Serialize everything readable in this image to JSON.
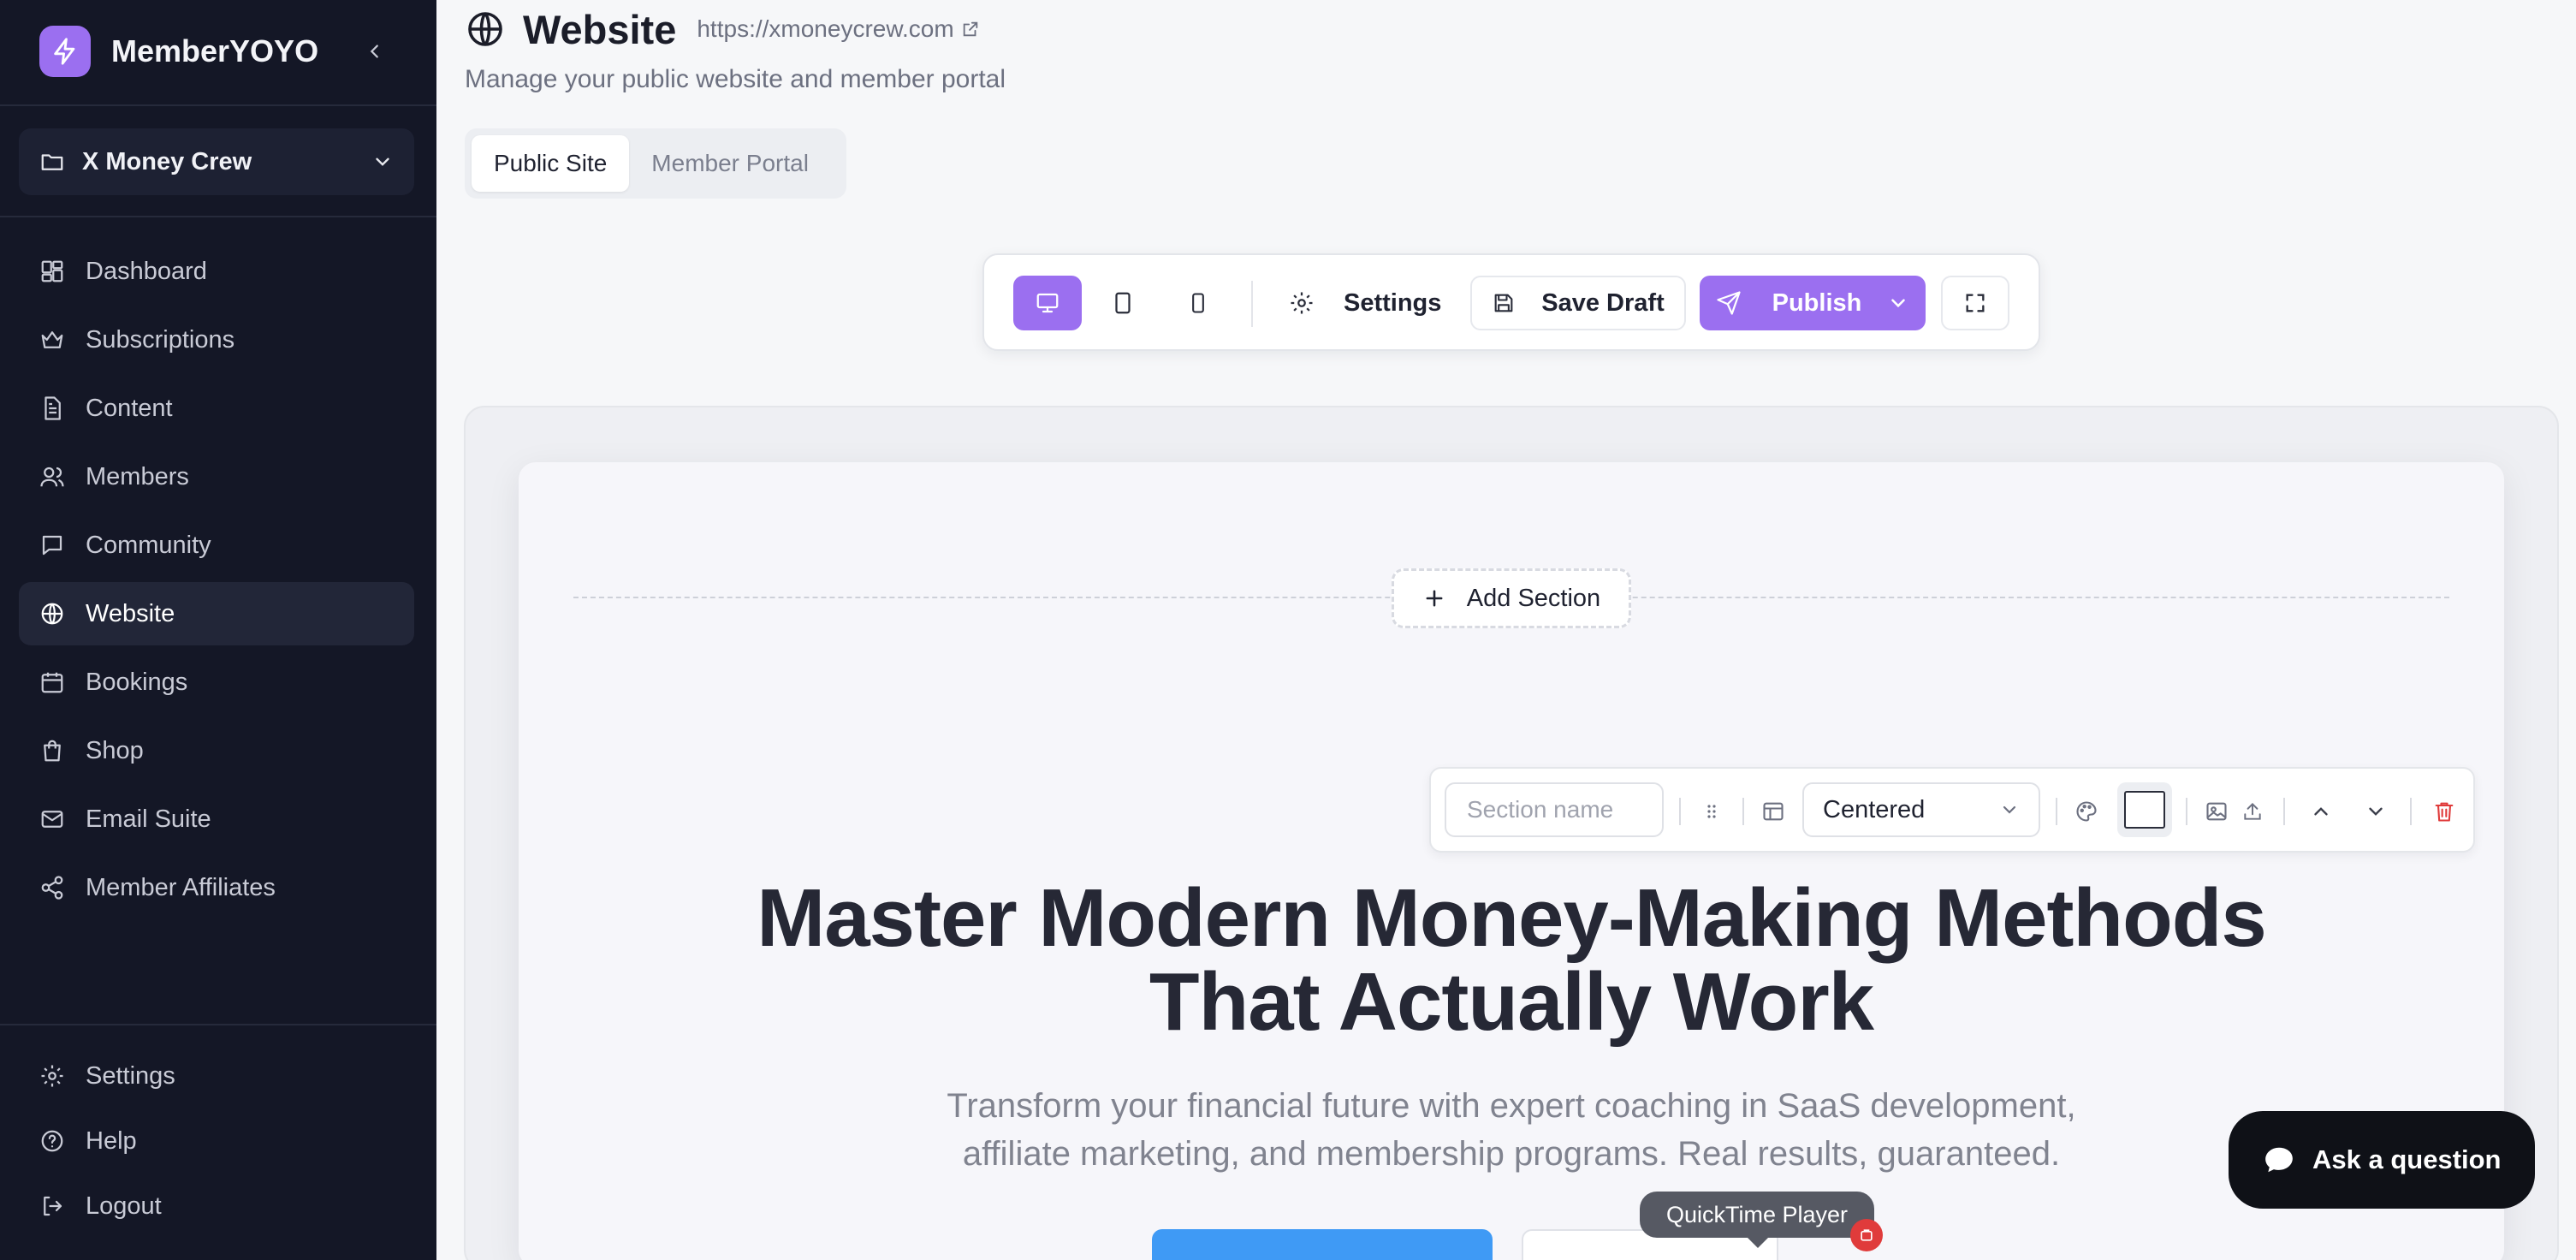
{
  "app": {
    "name": "MemberYOYO",
    "workspace": "X Money Crew"
  },
  "sidebar": {
    "items": [
      {
        "label": "Dashboard",
        "icon": "dashboard-icon"
      },
      {
        "label": "Subscriptions",
        "icon": "crown-icon"
      },
      {
        "label": "Content",
        "icon": "document-icon"
      },
      {
        "label": "Members",
        "icon": "users-icon"
      },
      {
        "label": "Community",
        "icon": "chat-icon"
      },
      {
        "label": "Website",
        "icon": "globe-icon",
        "active": true
      },
      {
        "label": "Bookings",
        "icon": "calendar-icon"
      },
      {
        "label": "Shop",
        "icon": "bag-icon"
      },
      {
        "label": "Email Suite",
        "icon": "mail-icon"
      },
      {
        "label": "Member Affiliates",
        "icon": "share-icon"
      }
    ],
    "bottom": [
      {
        "label": "Settings",
        "icon": "gear-icon"
      },
      {
        "label": "Help",
        "icon": "help-icon"
      },
      {
        "label": "Logout",
        "icon": "logout-icon"
      }
    ]
  },
  "header": {
    "title": "Website",
    "url": "https://xmoneycrew.com",
    "subtitle": "Manage your public website and member portal"
  },
  "tabs": [
    {
      "label": "Public Site",
      "active": true
    },
    {
      "label": "Member Portal",
      "active": false
    }
  ],
  "toolbar": {
    "settings_label": "Settings",
    "save_draft_label": "Save Draft",
    "publish_label": "Publish",
    "active_device": "desktop"
  },
  "canvas": {
    "add_section_label": "Add Section",
    "section_bar": {
      "name_placeholder": "Section name",
      "layout_value": "Centered"
    },
    "hero": {
      "title_line1": "Master Modern Money-Making Methods",
      "title_line2": "That Actually Work",
      "subtitle_line1": "Transform your financial future with expert coaching in SaaS development,",
      "subtitle_line2": "affiliate marketing, and membership programs. Real results, guaranteed."
    }
  },
  "overlays": {
    "ask_label": "Ask a question",
    "tooltip_label": "QuickTime Player"
  },
  "colors": {
    "sidebar_bg": "#141726",
    "accent": "#9b6ff0",
    "cta_blue": "#3f9af5",
    "delete_red": "#e03b3b"
  }
}
